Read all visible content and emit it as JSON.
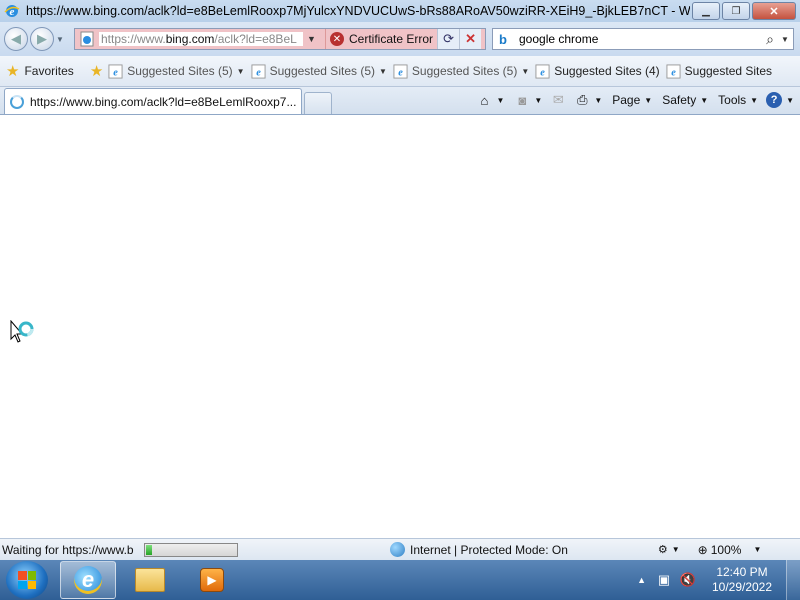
{
  "window": {
    "title": "https://www.bing.com/aclk?ld=e8BeLemlRooxp7MjYulcxYNDVUCUwS-bRs88ARoAV50wziRR-XEiH9_-BjkLEB7nCT - Windows ...",
    "minimize": "▁",
    "restore": "❐",
    "close": "✕"
  },
  "nav": {
    "back_icon": "back-icon",
    "forward_icon": "forward-icon",
    "address_gray": "https://www.",
    "address_dark": "bing.com",
    "address_tail": "/aclk?ld=e8BeL",
    "certificate_error": "Certificate Error",
    "refresh_icon": "refresh-icon",
    "stop_icon": "stop-icon",
    "search_value": "google chrome",
    "search_icon": "search-icon"
  },
  "favorites": {
    "label": "Favorites",
    "suggested": [
      "Suggested Sites (5)",
      "Suggested Sites (5)",
      "Suggested Sites (5)",
      "Suggested Sites (4)",
      "Suggested Sites"
    ]
  },
  "tab": {
    "title": "https://www.bing.com/aclk?ld=e8BeLemlRooxp7..."
  },
  "commands": {
    "page": "Page",
    "safety": "Safety",
    "tools": "Tools",
    "help": "?"
  },
  "status": {
    "text": "Waiting for https://www.b",
    "progress": 0.06,
    "zone": "Internet | Protected Mode: On",
    "zoom": "100%"
  },
  "taskbar": {
    "time": "12:40 PM",
    "date": "10/29/2022"
  },
  "colors": {
    "cert_error_bg": "#f0c3c7",
    "taskbar": "#2f5f95",
    "progress_fill": "#27a427"
  }
}
